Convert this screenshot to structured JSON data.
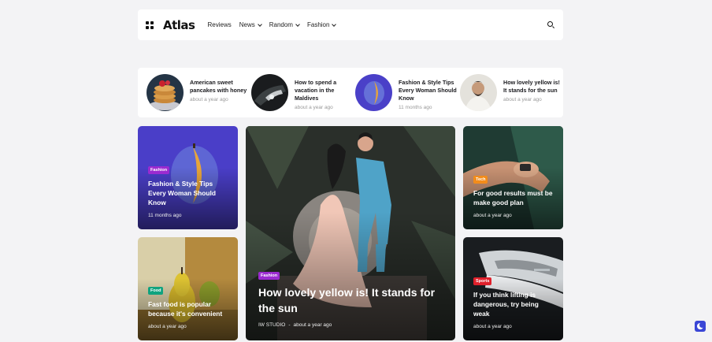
{
  "header": {
    "logo": "Atlas",
    "nav": [
      {
        "label": "Reviews",
        "has_dropdown": false
      },
      {
        "label": "News",
        "has_dropdown": true
      },
      {
        "label": "Random",
        "has_dropdown": true
      },
      {
        "label": "Fashion",
        "has_dropdown": true
      }
    ],
    "menu_icon": "grid-menu-icon",
    "search_icon": "search-icon"
  },
  "strip": [
    {
      "title": "American sweet pancakes with honey",
      "time": "about a year ago",
      "thumb": "pancakes"
    },
    {
      "title": "How to spend a vacation in the Maldives",
      "time": "about a year ago",
      "thumb": "car"
    },
    {
      "title": "Fashion & Style Tips Every Woman Should Know",
      "time": "11 months ago",
      "thumb": "fruit"
    },
    {
      "title": "How lovely yellow is! It stands for the sun",
      "time": "about a year ago",
      "thumb": "man"
    }
  ],
  "cards": {
    "top_left": {
      "tag": "Fashion",
      "tag_color": "#9b2bd0",
      "title": "Fashion & Style Tips Every Woman Should Know",
      "time": "11 months ago"
    },
    "bottom_left": {
      "tag": "Food",
      "tag_color": "#10a37f",
      "title": "Fast food is popular because it's convenient",
      "time": "about a year ago"
    },
    "center": {
      "tag": "Fashion",
      "tag_color": "#9b2bd0",
      "title": "How lovely yellow is! It stands for the sun",
      "author": "IW STUDIO",
      "separator": "-",
      "time": "about a year ago"
    },
    "top_right": {
      "tag": "Tech",
      "tag_color": "#f28c1b",
      "title": "For good results must be make good plan",
      "time": "about a year ago"
    },
    "bottom_right": {
      "tag": "Sports",
      "tag_color": "#e0202b",
      "title": "If you think lifting is dangerous, try being weak",
      "time": "about a year ago"
    }
  },
  "theme": {
    "accent": "#3a46d6",
    "dark_mode_icon": "moon-icon"
  }
}
